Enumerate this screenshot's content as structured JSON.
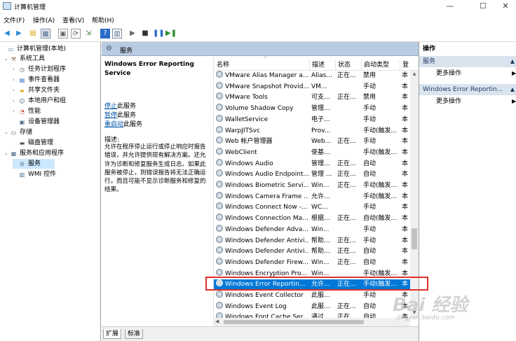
{
  "window": {
    "title": "计算机管理",
    "min": "—",
    "max": "☐",
    "close": "✕"
  },
  "menu": [
    "文件(F)",
    "操作(A)",
    "查看(V)",
    "帮助(H)"
  ],
  "tree": [
    {
      "label": "计算机管理(本地)",
      "icon": "computer-icon",
      "exp": ""
    },
    {
      "label": "系统工具",
      "icon": "tools-icon",
      "exp": "⌄"
    },
    {
      "label": "任务计划程序",
      "icon": "clock-icon",
      "exp": "›"
    },
    {
      "label": "事件查看器",
      "icon": "event-icon",
      "exp": "›"
    },
    {
      "label": "共享文件夹",
      "icon": "folder-icon",
      "exp": "›"
    },
    {
      "label": "本地用户和组",
      "icon": "users-icon",
      "exp": "›"
    },
    {
      "label": "性能",
      "icon": "performance-icon",
      "exp": "›"
    },
    {
      "label": "设备管理器",
      "icon": "device-icon",
      "exp": ""
    },
    {
      "label": "存储",
      "icon": "storage-icon",
      "exp": "⌄"
    },
    {
      "label": "磁盘管理",
      "icon": "disk-icon",
      "exp": ""
    },
    {
      "label": "服务和应用程序",
      "icon": "apps-icon",
      "exp": "⌄"
    },
    {
      "label": "服务",
      "icon": "services-icon",
      "exp": ""
    },
    {
      "label": "WMI 控件",
      "icon": "wmi-icon",
      "exp": ""
    }
  ],
  "header": {
    "title": "服务"
  },
  "info": {
    "service_title": "Windows Error Reporting Service",
    "stop_link": "停止",
    "stop_suffix": "此服务",
    "pause_link": "暂停",
    "pause_suffix": "此服务",
    "restart_link": "重启动",
    "restart_suffix": "此服务",
    "desc_label": "描述:",
    "desc_text": "允许在程序停止运行或停止响应时报告错误，并允许提供现有解决方案。还允许为诊断和修复服务生成日志。如果此服务被停止，则错误报告将无法正确运行，而且可能不显示诊断服务和修复的结果。"
  },
  "columns": {
    "name": "名称",
    "desc": "描述",
    "status": "状态",
    "start": "启动类型",
    "login": "登"
  },
  "rows": [
    {
      "name": "VMware Alias Manager a...",
      "desc": "Alias...",
      "status": "正在...",
      "start": "禁用",
      "login": "本"
    },
    {
      "name": "VMware Snapshot Provid...",
      "desc": "VM...",
      "status": "",
      "start": "手动",
      "login": "本"
    },
    {
      "name": "VMware Tools",
      "desc": "可支...",
      "status": "正在...",
      "start": "禁用",
      "login": "本"
    },
    {
      "name": "Volume Shadow Copy",
      "desc": "管理...",
      "status": "",
      "start": "手动",
      "login": "本"
    },
    {
      "name": "WalletService",
      "desc": "电子...",
      "status": "",
      "start": "手动",
      "login": "本"
    },
    {
      "name": "WarpJITSvc",
      "desc": "Prov...",
      "status": "",
      "start": "手动(触发...",
      "login": "本"
    },
    {
      "name": "Web 帐户管理器",
      "desc": "Web...",
      "status": "正在...",
      "start": "手动",
      "login": "本"
    },
    {
      "name": "WebClient",
      "desc": "使基...",
      "status": "",
      "start": "手动(触发...",
      "login": "本"
    },
    {
      "name": "Windows Audio",
      "desc": "管理...",
      "status": "正在...",
      "start": "自动",
      "login": "本"
    },
    {
      "name": "Windows Audio Endpoint...",
      "desc": "管理 ...",
      "status": "正在...",
      "start": "自动",
      "login": "本"
    },
    {
      "name": "Windows Biometric Servi...",
      "desc": "Win...",
      "status": "正在...",
      "start": "手动(触发...",
      "login": "本"
    },
    {
      "name": "Windows Camera Frame ...",
      "desc": "允许...",
      "status": "",
      "start": "手动(触发...",
      "login": "本"
    },
    {
      "name": "Windows Connect Now -...",
      "desc": "WC...",
      "status": "",
      "start": "手动",
      "login": "本"
    },
    {
      "name": "Windows Connection Ma...",
      "desc": "根据...",
      "status": "正在...",
      "start": "自动(触发...",
      "login": "本"
    },
    {
      "name": "Windows Defender Adva...",
      "desc": "Win...",
      "status": "",
      "start": "手动",
      "login": "本"
    },
    {
      "name": "Windows Defender Antivi...",
      "desc": "帮助...",
      "status": "正在...",
      "start": "手动",
      "login": "本"
    },
    {
      "name": "Windows Defender Antivi...",
      "desc": "帮助...",
      "status": "正在...",
      "start": "自动",
      "login": "本"
    },
    {
      "name": "Windows Defender Firew...",
      "desc": "Win...",
      "status": "正在...",
      "start": "自动",
      "login": "本"
    },
    {
      "name": "Windows Encryption Pro...",
      "desc": "Win...",
      "status": "",
      "start": "手动(触发...",
      "login": "本"
    },
    {
      "name": "Windows Error Reportin...",
      "desc": "允许...",
      "status": "正在...",
      "start": "手动(触发...",
      "login": "本"
    },
    {
      "name": "Windows Event Collector",
      "desc": "此服...",
      "status": "",
      "start": "手动",
      "login": "本"
    },
    {
      "name": "Windows Event Log",
      "desc": "此服...",
      "status": "正在...",
      "start": "自动",
      "login": "本"
    },
    {
      "name": "Windows Font Cache Ser...",
      "desc": "通过...",
      "status": "正在...",
      "start": "自动",
      "login": "本"
    }
  ],
  "tabs": {
    "ext": "扩展",
    "std": "标准"
  },
  "actions": {
    "title": "操作",
    "section1": "服务",
    "more1": "更多操作",
    "section2": "Windows Error Reportin...",
    "more2": "更多操作"
  },
  "watermark": {
    "logo": "Bai 经验",
    "url": "jingyan.baidu.com"
  }
}
